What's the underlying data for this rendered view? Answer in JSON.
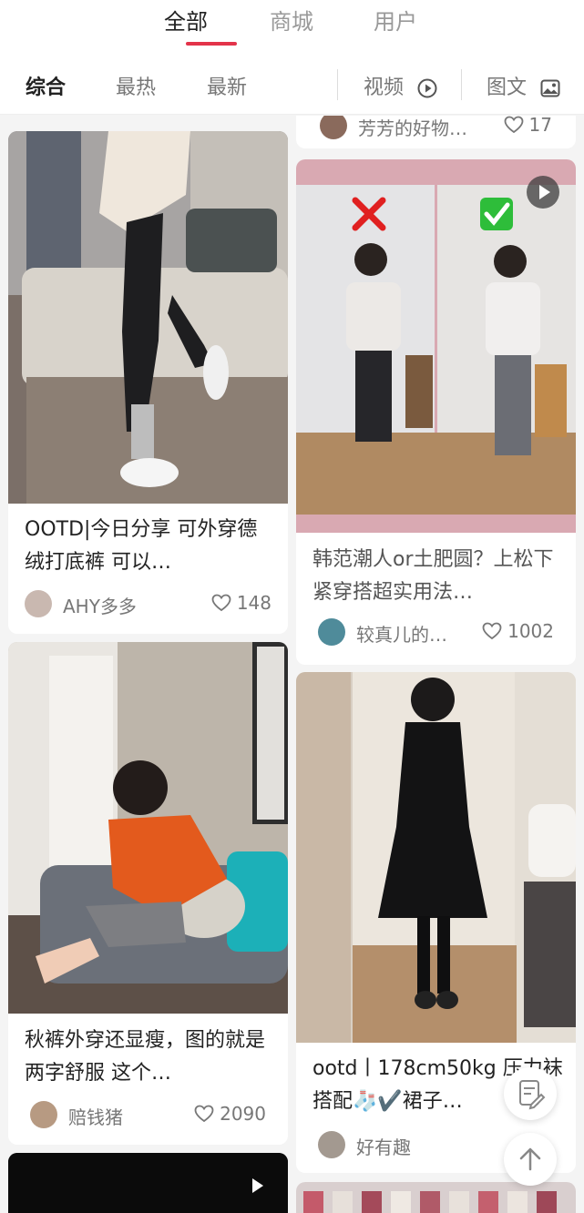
{
  "top_tabs": [
    "全部",
    "商城",
    "用户"
  ],
  "sort_bar": {
    "items": [
      "综合",
      "最热",
      "最新"
    ],
    "video_label": "视频",
    "image_text_label": "图文"
  },
  "cards": [
    {
      "title": "OOTD|今日分享 可外穿德绒打底裤 可以…",
      "author": "AHY多多",
      "likes": "148"
    },
    {
      "title": "韩范潮人or土肥圆？上松下紧穿搭超实用法…",
      "author": "较真儿的…",
      "likes": "1002"
    },
    {
      "title": "秋裤外穿还显瘦，图的就是两字舒服 这个…",
      "author": "赔钱猪",
      "likes": "2090"
    },
    {
      "title": "ootd丨178cm50kg 压力袜搭配🧦✔️裙子…",
      "author": "好有趣",
      "likes": ""
    }
  ],
  "partial_card": {
    "author": "芳芳的好物…",
    "likes": "17"
  },
  "colors": {
    "accent": "#e3334a",
    "background": "#f4f4f4"
  }
}
